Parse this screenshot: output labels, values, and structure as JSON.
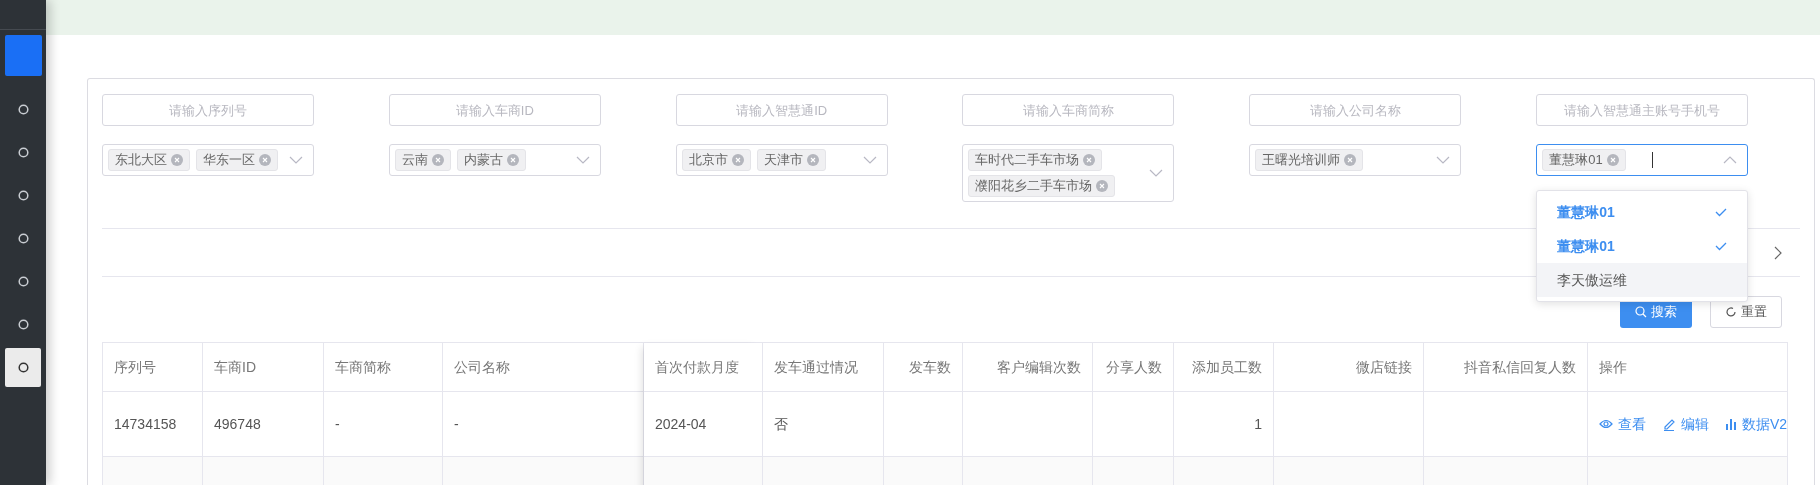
{
  "sidebar": {
    "items": [
      {
        "selected": false
      },
      {
        "selected": false
      },
      {
        "selected": false
      },
      {
        "selected": false
      },
      {
        "selected": false
      },
      {
        "selected": false
      },
      {
        "selected": true
      }
    ]
  },
  "filters": {
    "inputs": [
      {
        "placeholder": "请输入序列号"
      },
      {
        "placeholder": "请输入车商ID"
      },
      {
        "placeholder": "请输入智慧通ID"
      },
      {
        "placeholder": "请输入车商简称"
      },
      {
        "placeholder": "请输入公司名称"
      },
      {
        "placeholder": "请输入智慧通主账号手机号"
      }
    ],
    "selects": [
      {
        "tags": [
          "东北大区",
          "华东一区"
        ],
        "open": false
      },
      {
        "tags": [
          "云南",
          "内蒙古"
        ],
        "open": false
      },
      {
        "tags": [
          "北京市",
          "天津市"
        ],
        "open": false
      },
      {
        "tags": [
          "车时代二手车市场",
          "濮阳花乡二手车市场"
        ],
        "open": false
      },
      {
        "tags": [
          "王曙光培训师"
        ],
        "open": false
      },
      {
        "tags": [
          "董慧琳01"
        ],
        "open": true
      }
    ]
  },
  "dropdown": {
    "options": [
      {
        "label": "董慧琳01",
        "selected": true,
        "highlighted": false
      },
      {
        "label": "董慧琳01",
        "selected": true,
        "highlighted": false
      },
      {
        "label": "李天傲运维",
        "selected": false,
        "highlighted": true
      }
    ]
  },
  "buttons": [
    {
      "label": "搜索",
      "kind": "primary"
    },
    {
      "label": "重置",
      "kind": "default"
    }
  ],
  "table": {
    "columns": [
      {
        "label": "序列号",
        "numeric": false
      },
      {
        "label": "车商ID",
        "numeric": false
      },
      {
        "label": "车商简称",
        "numeric": false
      },
      {
        "label": "公司名称",
        "numeric": false
      },
      {
        "label": "首次付款月度",
        "numeric": false
      },
      {
        "label": "发车通过情况",
        "numeric": false
      },
      {
        "label": "发车数",
        "numeric": true
      },
      {
        "label": "客户编辑次数",
        "numeric": true
      },
      {
        "label": "分享人数",
        "numeric": true
      },
      {
        "label": "添加员工数",
        "numeric": true
      },
      {
        "label": "微店链接",
        "numeric": true
      },
      {
        "label": "抖音私信回复人数",
        "numeric": true
      },
      {
        "label": "操作",
        "numeric": false
      }
    ],
    "rows": [
      {
        "cells": [
          "14734158",
          "496748",
          "-",
          "-",
          "2024-04",
          "否",
          null,
          null,
          null,
          "1",
          null,
          null
        ],
        "actions": [
          {
            "kind": "view",
            "label": "查看"
          },
          {
            "kind": "edit",
            "label": "编辑"
          },
          {
            "kind": "data",
            "label": "数据V2"
          }
        ]
      }
    ]
  }
}
